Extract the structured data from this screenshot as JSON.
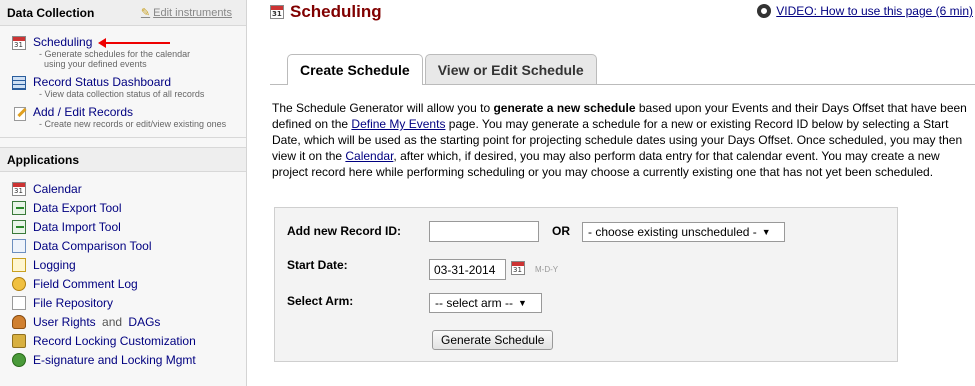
{
  "sidebar": {
    "data_collection": {
      "heading": "Data Collection",
      "edit_link": "Edit instruments",
      "items": [
        {
          "label": "Scheduling",
          "desc1": "- Generate schedules for the calendar",
          "desc2": "using your defined events"
        },
        {
          "label": "Record Status Dashboard",
          "desc1": "- View data collection status of all records",
          "desc2": ""
        },
        {
          "label": "Add / Edit Records",
          "desc1": "- Create new records or edit/view existing ones",
          "desc2": ""
        }
      ]
    },
    "applications": {
      "heading": "Applications",
      "items": [
        {
          "label": "Calendar"
        },
        {
          "label": "Data Export Tool"
        },
        {
          "label": "Data Import Tool"
        },
        {
          "label": "Data Comparison Tool"
        },
        {
          "label": "Logging"
        },
        {
          "label": "Field Comment Log"
        },
        {
          "label": "File Repository"
        },
        {
          "label": "User Rights",
          "and": "and",
          "extra": "DAGs"
        },
        {
          "label": "Record Locking Customization"
        },
        {
          "label": "E-signature and Locking Mgmt"
        }
      ]
    }
  },
  "main": {
    "title": "Scheduling",
    "video_link": "VIDEO: How to use this page (6 min)",
    "tabs": [
      {
        "label": "Create Schedule",
        "active": true
      },
      {
        "label": "View or Edit Schedule",
        "active": false
      }
    ],
    "intro": {
      "p1": "The Schedule Generator will allow you to ",
      "bold": "generate a new schedule",
      "p2": " based upon your Events and their Days Offset that have been defined on the ",
      "link1": "Define My Events",
      "p3": " page. You may generate a schedule for a new or existing Record ID below by selecting a Start Date, which will be used as the starting point for projecting schedule dates using your Days Offset. Once scheduled, you may then view it on the ",
      "link2": "Calendar",
      "p4": ", after which, if desired, you may also perform data entry for that calendar event. You may create a new project record here while performing scheduling or you may choose a currently existing one that has not yet been scheduled."
    },
    "form": {
      "record_label": "Add new Record ID:",
      "record_value": "",
      "or_label": "OR",
      "existing_select": "- choose existing unscheduled -",
      "start_label": "Start Date:",
      "start_value": "03-31-2014",
      "date_format": "M-D-Y",
      "arm_label": "Select Arm:",
      "arm_select": "-- select arm --",
      "generate_button": "Generate Schedule"
    }
  }
}
